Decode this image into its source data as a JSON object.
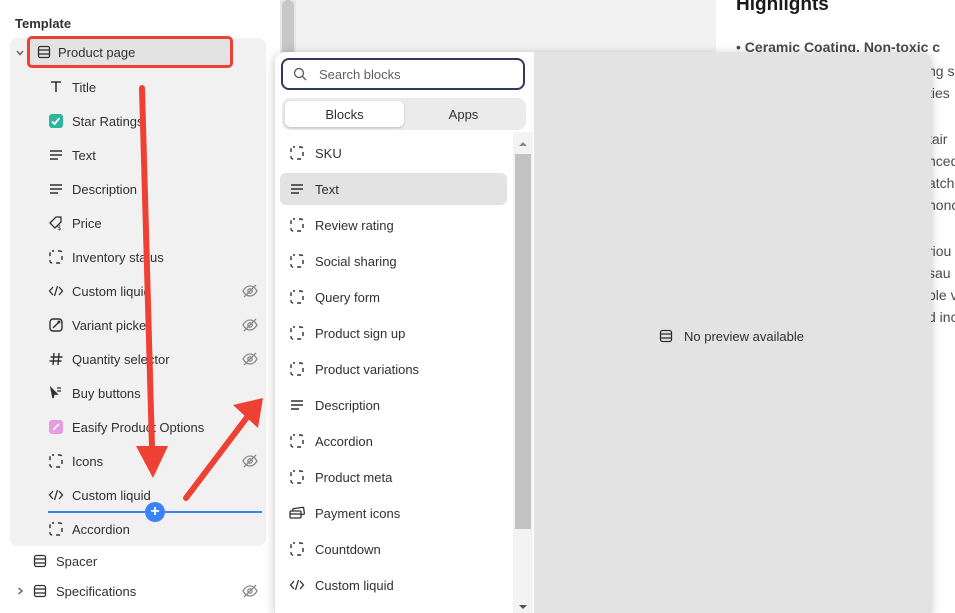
{
  "sidebar": {
    "heading": "Template",
    "product_page": "Product page",
    "items": [
      {
        "label": "Title",
        "icon": "title-icon"
      },
      {
        "label": "Star Ratings",
        "icon": "star-ratings-app-icon"
      },
      {
        "label": "Text",
        "icon": "text-icon"
      },
      {
        "label": "Description",
        "icon": "text-icon"
      },
      {
        "label": "Price",
        "icon": "price-tag-icon"
      },
      {
        "label": "Inventory status",
        "icon": "block-icon"
      },
      {
        "label": "Custom liquid",
        "icon": "code-icon",
        "hidden": true
      },
      {
        "label": "Variant picker",
        "icon": "variant-icon",
        "hidden": true
      },
      {
        "label": "Quantity selector",
        "icon": "hash-icon",
        "hidden": true
      },
      {
        "label": "Buy buttons",
        "icon": "buy-button-icon"
      },
      {
        "label": "Easify Product Options",
        "icon": "easify-app-icon"
      },
      {
        "label": "Icons",
        "icon": "block-icon",
        "hidden": true
      },
      {
        "label": "Custom liquid",
        "icon": "code-icon"
      },
      {
        "label": "Accordion",
        "icon": "block-icon"
      }
    ],
    "sections": [
      {
        "label": "Spacer"
      },
      {
        "label": "Specifications",
        "hidden": true
      }
    ]
  },
  "popover": {
    "search_placeholder": "Search blocks",
    "tabs": [
      "Blocks",
      "Apps"
    ],
    "blocks": [
      {
        "label": "SKU",
        "icon": "block-icon"
      },
      {
        "label": "Text",
        "icon": "text-icon",
        "selected": true
      },
      {
        "label": "Review rating",
        "icon": "block-icon"
      },
      {
        "label": "Social sharing",
        "icon": "block-icon"
      },
      {
        "label": "Query form",
        "icon": "block-icon"
      },
      {
        "label": "Product sign up",
        "icon": "block-icon"
      },
      {
        "label": "Product variations",
        "icon": "block-icon"
      },
      {
        "label": "Description",
        "icon": "text-icon"
      },
      {
        "label": "Accordion",
        "icon": "block-icon"
      },
      {
        "label": "Product meta",
        "icon": "block-icon"
      },
      {
        "label": "Payment icons",
        "icon": "payment-icon"
      },
      {
        "label": "Countdown",
        "icon": "block-icon"
      },
      {
        "label": "Custom liquid",
        "icon": "code-icon"
      }
    ],
    "no_preview": "No preview available"
  },
  "preview": {
    "heading": "Highlights",
    "lines": [
      "Ceramic Coating. Non-toxic c",
      "ng s",
      "ties",
      "tair",
      "nced",
      "atch",
      "nonc",
      "riou",
      "sau",
      "ble v",
      "d inc"
    ]
  },
  "colors": {
    "annotation_red": "#ef4034",
    "drop_blue": "#3b82f6"
  }
}
